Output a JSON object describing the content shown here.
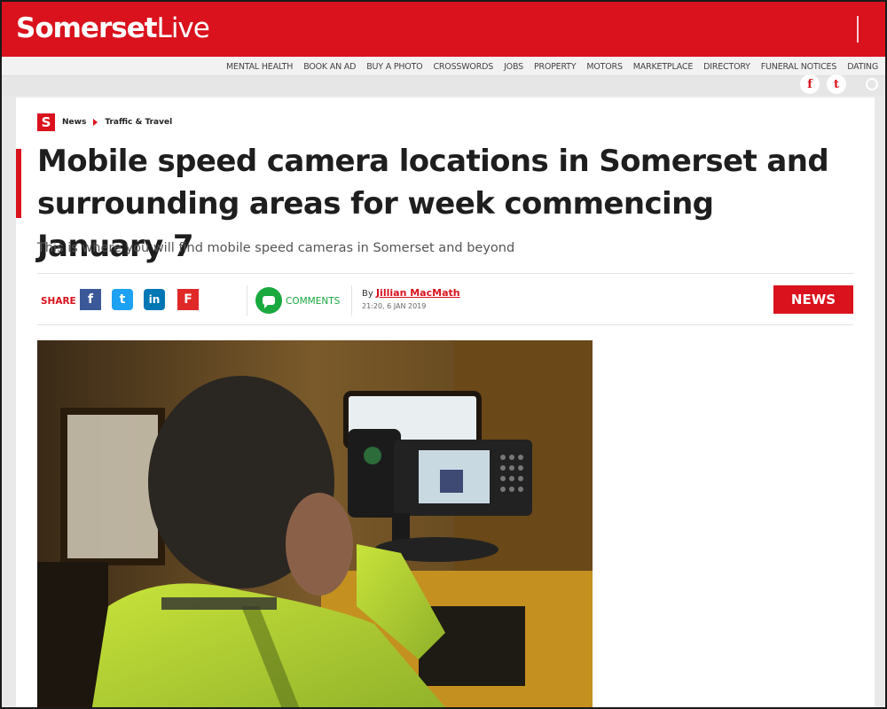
{
  "header": {
    "logo_bold": "Somerset",
    "logo_light": "Live"
  },
  "utility_links": [
    "MENTAL HEALTH",
    "BOOK AN AD",
    "BUY A PHOTO",
    "CROSSWORDS",
    "JOBS",
    "PROPERTY",
    "MOTORS",
    "MARKETPLACE",
    "DIRECTORY",
    "FUNERAL NOTICES",
    "DATING"
  ],
  "social": {
    "facebook_glyph": "f",
    "twitter_glyph": "t"
  },
  "breadcrumb": {
    "brand_letter": "S",
    "items": [
      "News",
      "Traffic & Travel"
    ]
  },
  "article": {
    "headline": "Mobile speed camera locations in Somerset and surrounding areas for week commencing January 7",
    "standfirst": "This is where you will find mobile speed cameras in Somerset and beyond",
    "share_label": "SHARE",
    "comments_label": "COMMENTS",
    "byline_prefix": "By",
    "author": "Jillian MacMath",
    "date": "21:20, 6 JAN 2019",
    "category_badge": "NEWS"
  },
  "share_buttons": [
    {
      "name": "facebook",
      "glyph": "f",
      "color": "#3b5998"
    },
    {
      "name": "twitter",
      "glyph": "t",
      "color": "#1da1f2"
    },
    {
      "name": "linkedin",
      "glyph": "in",
      "color": "#0077b5"
    },
    {
      "name": "flipboard",
      "glyph": "F",
      "color": "#e12828"
    }
  ],
  "colors": {
    "brand": "#d9121d",
    "comments": "#1aa93f"
  },
  "photo": {
    "alt": "speed-camera-operator"
  }
}
